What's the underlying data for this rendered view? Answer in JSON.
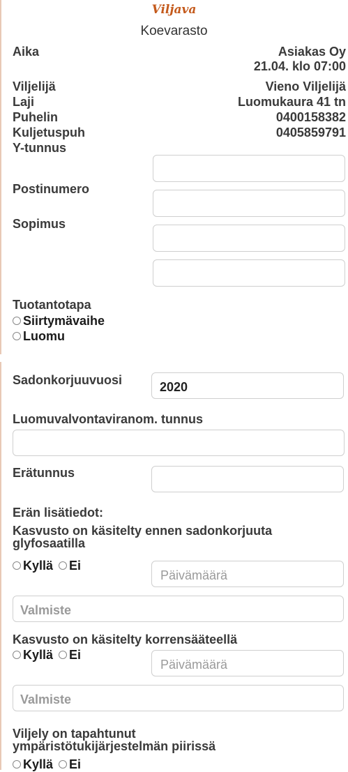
{
  "header": {
    "logo": "Viljava",
    "title": "Koevarasto"
  },
  "info": {
    "aika_label": "Aika",
    "customer": "Asiakas Oy",
    "aika_value": "21.04. klo 07:00",
    "viljelija_label": "Viljelijä",
    "viljelija_value": "Vieno Viljelijä",
    "laji_label": "Laji",
    "laji_value": "Luomukaura 41 tn",
    "puhelin_label": "Puhelin",
    "puhelin_value": "0400158382",
    "kuljetuspuh_label": "Kuljetuspuh",
    "kuljetuspuh_value": "0405859791"
  },
  "form1": {
    "ytunnus_label": "Y-tunnus",
    "postinumero_label": "Postinumero",
    "sopimus_label": "Sopimus",
    "tuotantotapa_label": "Tuotantotapa",
    "option_siirtyma": "Siirtymävaihe",
    "option_luomu": "Luomu"
  },
  "form2": {
    "sadonkorjuuvuosi_label": "Sadonkorjuuvuosi",
    "sadonkorjuuvuosi_value": "2020",
    "luomuvalvonta_label": "Luomuvalvontaviranom. tunnus",
    "eratunnus_label": "Erätunnus",
    "eran_lisatiedot_label": "Erän lisätiedot:",
    "glyfosaatti_question_line1": "Kasvusto on käsitelty ennen sadonkorjuuta",
    "glyfosaatti_question_line2": "glyfosaatilla",
    "yes": "Kyllä",
    "no": "Ei",
    "date_placeholder": "Päivämäärä",
    "valmiste_placeholder": "Valmiste",
    "korrensaate_question": "Kasvusto on käsitelty korrensääteellä",
    "ymparisto_question_line1": "Viljely on tapahtunut",
    "ymparisto_question_line2": "ympäristötukijärjestelmän piirissä"
  }
}
